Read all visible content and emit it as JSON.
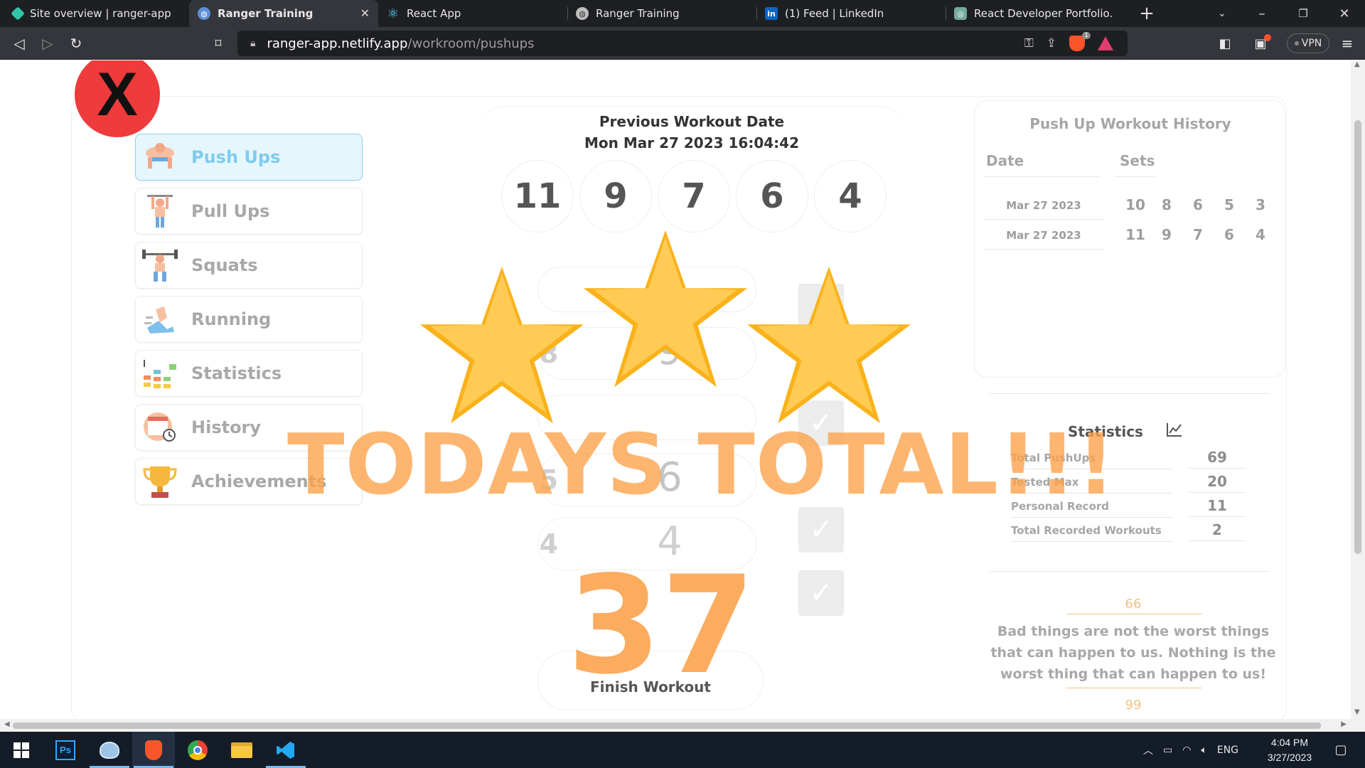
{
  "browser": {
    "tabs": [
      {
        "title": "Site overview | ranger-app",
        "icon": "netlify-icon",
        "color": "#32c6a9"
      },
      {
        "title": "Ranger Training",
        "icon": "globe-icon",
        "color": "#9fc5ff",
        "active": true
      },
      {
        "title": "React App",
        "icon": "react-icon",
        "color": "#61dafb"
      },
      {
        "title": "Ranger Training",
        "icon": "globe-icon",
        "color": "#cfcfcf"
      },
      {
        "title": "(1) Feed | LinkedIn",
        "icon": "linkedin-icon",
        "color": "#0a66c2"
      },
      {
        "title": "React Developer Portfolio.",
        "icon": "chatgpt-icon",
        "color": "#74aa9c"
      }
    ],
    "url_host": "ranger-app.netlify.app",
    "url_path": "/workroom/pushups",
    "shields_badge": "1",
    "vpn_label": "VPN"
  },
  "page": {
    "close_symbol": "X",
    "menu": [
      {
        "label": "Push Ups",
        "icon": "pushups-icon",
        "active": true
      },
      {
        "label": "Pull Ups",
        "icon": "pullups-icon"
      },
      {
        "label": "Squats",
        "icon": "squats-icon"
      },
      {
        "label": "Running",
        "icon": "running-icon"
      },
      {
        "label": "Statistics",
        "icon": "statistics-icon"
      },
      {
        "label": "History",
        "icon": "history-icon"
      },
      {
        "label": "Achievements",
        "icon": "trophy-icon"
      }
    ],
    "previous_workout": {
      "title": "Previous Workout Date",
      "date": "Mon Mar 27 2023 16:04:42",
      "sets": [
        "11",
        "9",
        "7",
        "6",
        "4"
      ]
    },
    "current_rows": [
      {
        "target": "8",
        "done": "9"
      },
      {
        "target": "5",
        "done": "6"
      },
      {
        "target": "4",
        "done": "4"
      }
    ],
    "finish_button": "Finish Workout",
    "history": {
      "title": "Push Up Workout History",
      "col_date": "Date",
      "col_sets": "Sets",
      "rows": [
        {
          "date": "Mar 27 2023",
          "sets": [
            "10",
            "8",
            "6",
            "5",
            "3"
          ]
        },
        {
          "date": "Mar 27 2023",
          "sets": [
            "11",
            "9",
            "7",
            "6",
            "4"
          ]
        }
      ]
    },
    "statistics": {
      "title": "Statistics",
      "items": [
        {
          "label": "Total PushUps",
          "value": "69"
        },
        {
          "label": "Tested Max",
          "value": "20"
        },
        {
          "label": "Personal Record",
          "value": "11"
        },
        {
          "label": "Total Recorded Workouts",
          "value": "2"
        }
      ]
    },
    "quote": {
      "open_mark": "66",
      "text": "Bad things are not the worst things that can happen to us. Nothing is the worst thing that can happen to us!",
      "close_mark": "99"
    },
    "overlay": {
      "heading": "TODAYS TOTAL!!!",
      "total": "37",
      "stars_filled": 3,
      "stars_total": 3,
      "star_color": "#ffc94a",
      "star_edge_color": "#f9b21a"
    }
  },
  "taskbar": {
    "apps": [
      "start-icon",
      "photoshop-icon",
      "paint-icon",
      "brave-icon",
      "chrome-icon",
      "file-explorer-icon",
      "vscode-icon"
    ],
    "language": "ENG",
    "time": "4:04 PM",
    "date": "3/27/2023"
  }
}
